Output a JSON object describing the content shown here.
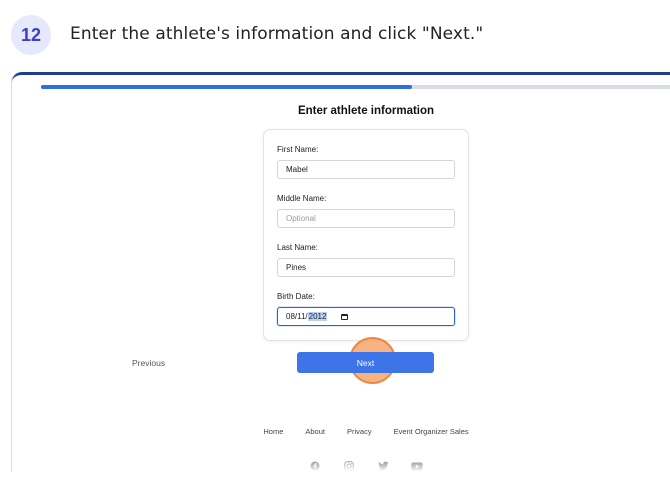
{
  "step": {
    "number": "12",
    "instruction": "Enter the athlete's information and click \"Next.\""
  },
  "progress": {
    "fraction": 0.58
  },
  "form": {
    "title": "Enter athlete information",
    "fields": [
      {
        "label": "First Name:",
        "value": "Mabel",
        "placeholder": ""
      },
      {
        "label": "Middle Name:",
        "value": "",
        "placeholder": "Optional"
      },
      {
        "label": "Last Name:",
        "value": "Pines",
        "placeholder": ""
      },
      {
        "label": "Birth Date:",
        "value_prefix": "08/11/",
        "value_selected": "2012"
      }
    ]
  },
  "nav": {
    "previous_label": "Previous",
    "next_label": "Next"
  },
  "footer": {
    "links": [
      "Home",
      "About",
      "Privacy",
      "Event Organizer Sales"
    ],
    "social_icons": [
      "facebook-icon",
      "instagram-icon",
      "twitter-icon",
      "youtube-icon"
    ]
  },
  "colors": {
    "accent": "#3d74e8",
    "progress": "#2f6de1",
    "click_marker": "#f69e60",
    "badge_bg": "#e6e8fb",
    "badge_text": "#3b3fc4"
  }
}
